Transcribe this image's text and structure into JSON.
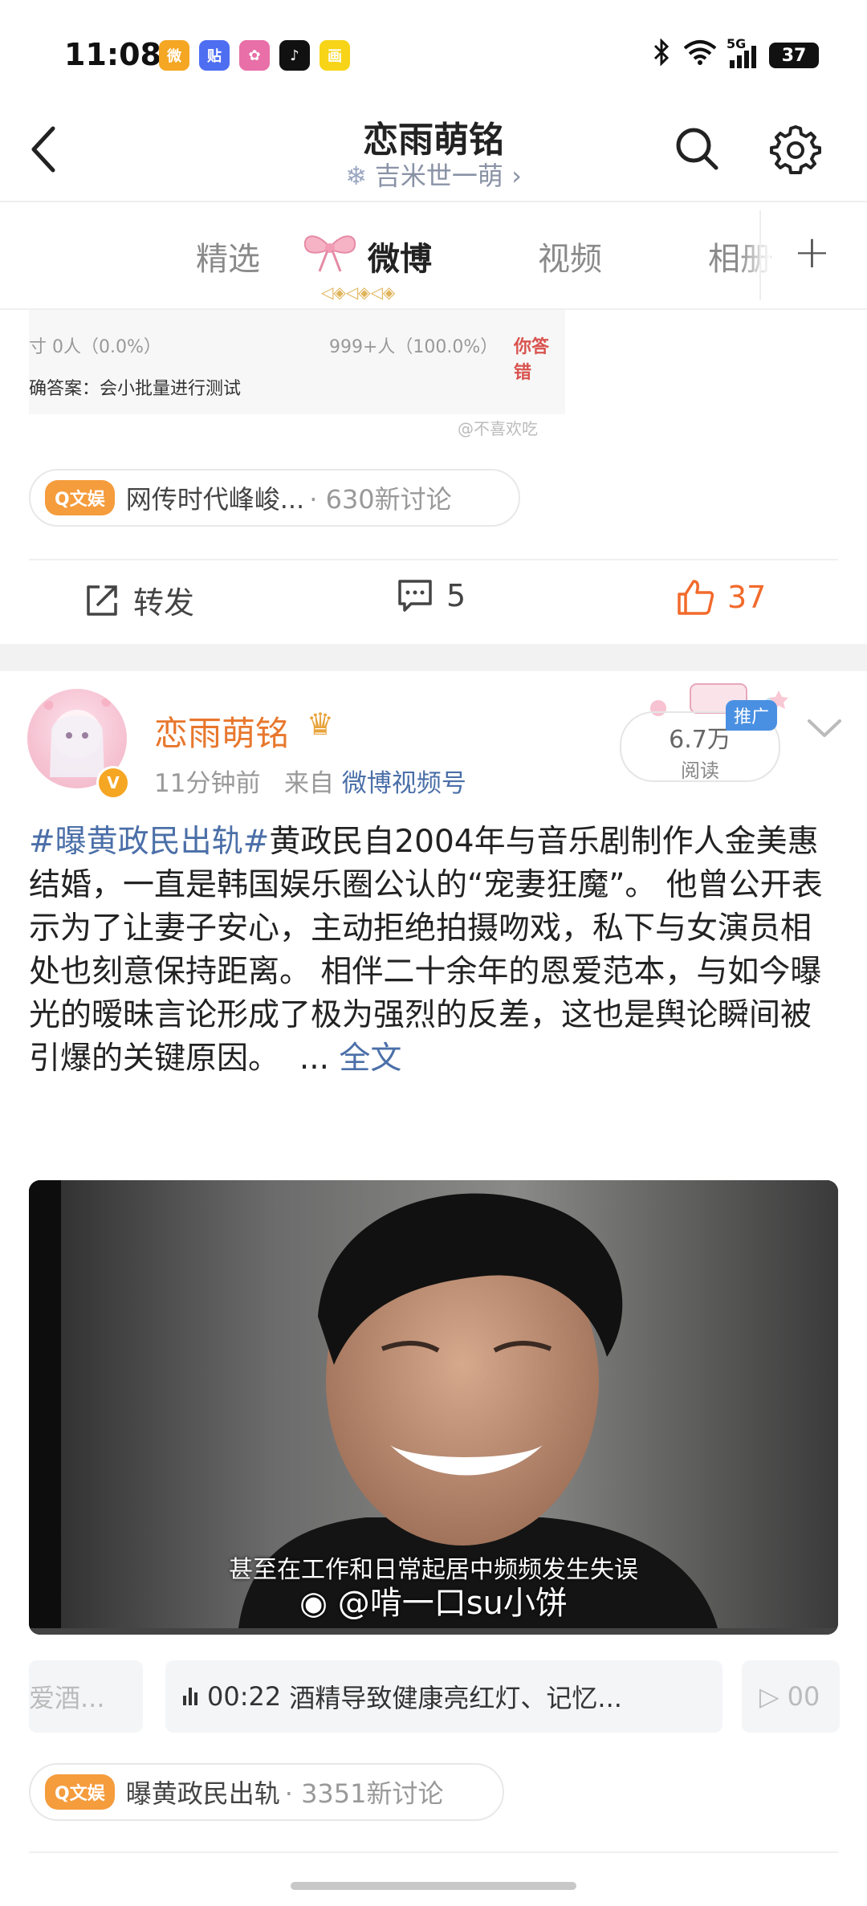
{
  "status_bar": {
    "time": "11:08",
    "network": "5G",
    "battery": "37",
    "app_icons": [
      {
        "name": "weibo-app-icon",
        "glyph": "微",
        "color": "#f5a623"
      },
      {
        "name": "tieba-app-icon",
        "glyph": "贴",
        "color": "#4e6ef2"
      },
      {
        "name": "colorful-app-icon",
        "glyph": "✿",
        "color": "#e86fa7"
      },
      {
        "name": "tiktok-app-icon",
        "glyph": "♪",
        "color": "#111111"
      },
      {
        "name": "yellow-app-icon",
        "glyph": "画",
        "color": "#f7d417"
      }
    ]
  },
  "header": {
    "title": "恋雨萌铭",
    "subtitle": "吉米世一萌 ›"
  },
  "tabs": [
    {
      "label": "精选",
      "active": false
    },
    {
      "label": "微博",
      "active": true
    },
    {
      "label": "视频",
      "active": false
    },
    {
      "label": "相册",
      "active": false
    }
  ],
  "post1": {
    "image_text": {
      "row1_left": "寸 0人（0.0%）",
      "row1_mid": "999+人（100.0%）",
      "row1_right": "你答错",
      "row2": "确答案：会小批量进行测试",
      "watermark": "@不喜欢吃"
    },
    "topic": {
      "badge": "Q文娱",
      "text": "网传时代峰峻...",
      "count": "· 630新讨论"
    },
    "actions": {
      "repost": "转发",
      "comments": "5",
      "likes": "37"
    }
  },
  "post2": {
    "author": "恋雨萌铭",
    "verified_badge": "V",
    "time": "11分钟前",
    "source_prefix": "来自",
    "source": "微博视频号",
    "reads": "6.7万",
    "reads_label": "阅读",
    "promo": "推广",
    "hashtag": "#曝黄政民出轨#",
    "body": "黄政民自2004年与音乐剧制作人金美惠结婚，一直是韩国娱乐圈公认的“宠妻狂魔”。 他曾公开表示为了让妻子安心，主动拒绝拍摄吻戏，私下与女演员相处也刻意保持距离。 相伴二十余年的恩爱范本，与如今曝光的暧昧言论形成了极为强烈的反差，这也是舆论瞬间被引爆的关键原因。",
    "more_prefix": "...",
    "more": "全文",
    "video": {
      "caption": "甚至在工作和日常起居中频频发生失误",
      "watermark": "@啃一口su小饼"
    },
    "chapters": [
      {
        "text": "爱酒..."
      },
      {
        "time": "00:22",
        "text": "酒精导致健康亮红灯、记忆..."
      },
      {
        "time": "00"
      }
    ],
    "topic": {
      "badge": "Q文娱",
      "text": "曝黄政民出轨",
      "count": "· 3351新讨论"
    }
  }
}
